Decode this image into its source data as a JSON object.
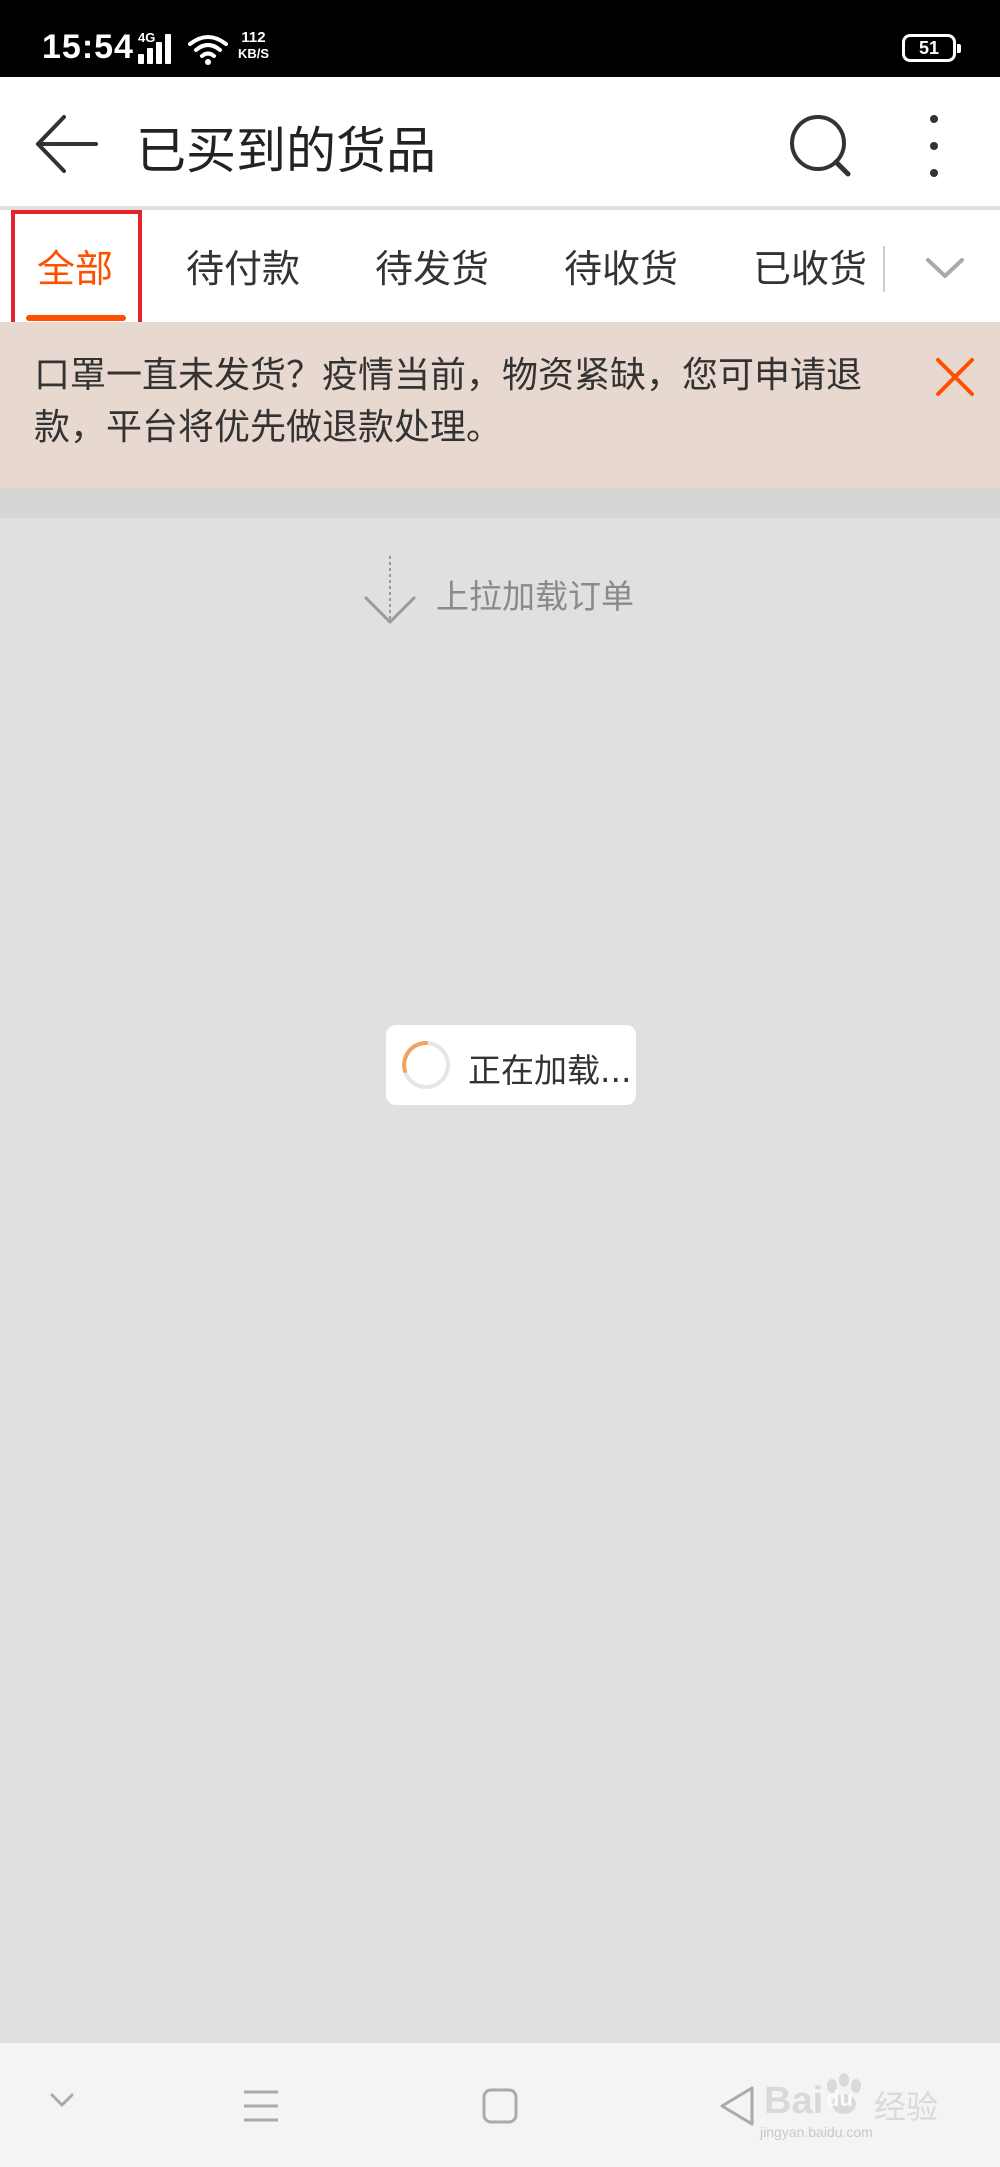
{
  "status_bar": {
    "time": "15:54",
    "network_type": "4G",
    "speed_value": "112",
    "speed_unit": "KB/S",
    "battery_level": "51"
  },
  "title_bar": {
    "title": "已买到的货品",
    "back_icon": "arrow-left",
    "search_icon": "search",
    "more_icon": "more-vertical"
  },
  "tabs": [
    {
      "label": "全部",
      "active": true
    },
    {
      "label": "待付款",
      "active": false
    },
    {
      "label": "待发货",
      "active": false
    },
    {
      "label": "待收货",
      "active": false
    },
    {
      "label": "已收货",
      "active": false
    }
  ],
  "notice": {
    "text": "口罩一直未发货？疫情当前，物资紧缺，您可申请退款，平台将优先做退款处理。",
    "close_icon": "close"
  },
  "pull_hint": {
    "text": "上拉加载订单"
  },
  "loading": {
    "text": "正在加载..."
  },
  "watermark": {
    "brand_prefix": "Bai",
    "brand_suffix": "du",
    "brand_cn": "经验",
    "site": "jingyan.baidu.com"
  },
  "colors": {
    "accent": "#ff5000",
    "highlight_box": "#e4262c",
    "notice_bg": "#e8d9d0"
  }
}
